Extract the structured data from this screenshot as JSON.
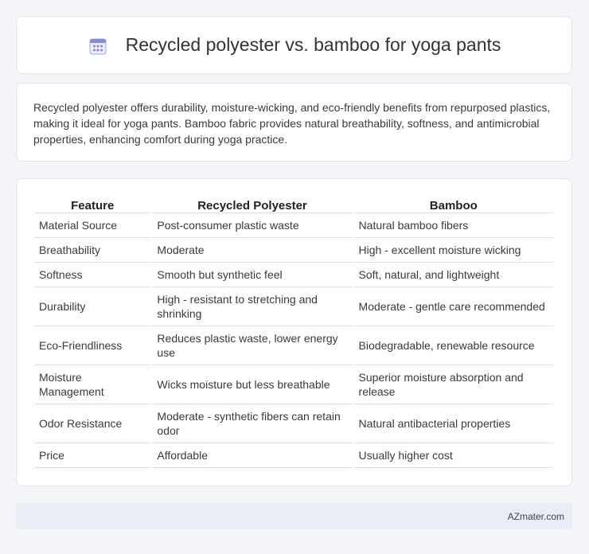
{
  "header": {
    "icon": "calendar-icon",
    "title": "Recycled polyester vs. bamboo for yoga pants"
  },
  "summary": {
    "text": "Recycled polyester offers durability, moisture-wicking, and eco-friendly benefits from repurposed plastics, making it ideal for yoga pants. Bamboo fabric provides natural breathability, softness, and antimicrobial properties, enhancing comfort during yoga practice."
  },
  "table": {
    "headers": [
      "Feature",
      "Recycled Polyester",
      "Bamboo"
    ],
    "rows": [
      [
        "Material Source",
        "Post-consumer plastic waste",
        "Natural bamboo fibers"
      ],
      [
        "Breathability",
        "Moderate",
        "High - excellent moisture wicking"
      ],
      [
        "Softness",
        "Smooth but synthetic feel",
        "Soft, natural, and lightweight"
      ],
      [
        "Durability",
        "High - resistant to stretching and shrinking",
        "Moderate - gentle care recommended"
      ],
      [
        "Eco-Friendliness",
        "Reduces plastic waste, lower energy use",
        "Biodegradable, renewable resource"
      ],
      [
        "Moisture Management",
        "Wicks moisture but less breathable",
        "Superior moisture absorption and release"
      ],
      [
        "Odor Resistance",
        "Moderate - synthetic fibers can retain odor",
        "Natural antibacterial properties"
      ],
      [
        "Price",
        "Affordable",
        "Usually higher cost"
      ]
    ]
  },
  "footer": {
    "text": "AZmater.com"
  },
  "colors": {
    "background": "#f3f5f9",
    "card": "#ffffff",
    "footer": "#e8edf6",
    "icon_accent": "#6b7fd7"
  }
}
